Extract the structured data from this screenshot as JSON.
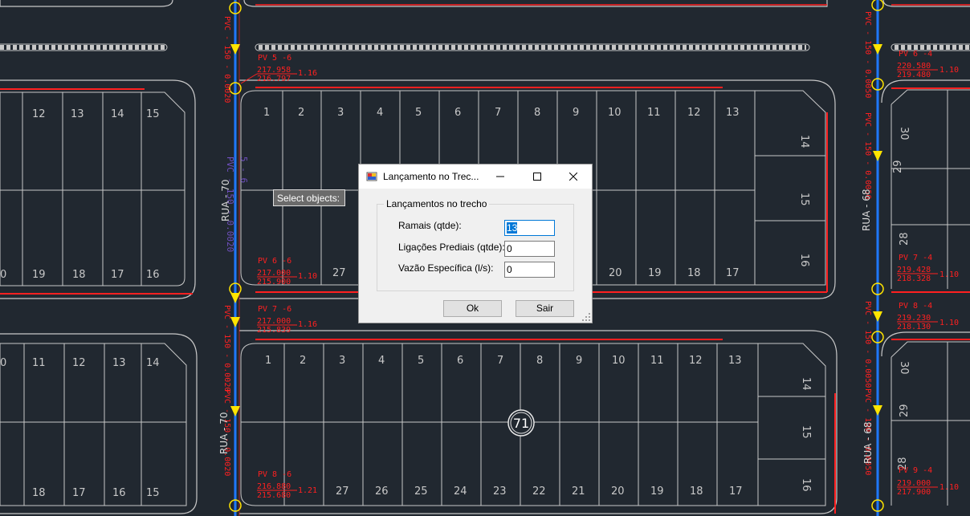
{
  "tooltip": "Select objects:",
  "dialog": {
    "title": "Lançamento no Trec...",
    "group_label": "Lançamentos no trecho",
    "fields": [
      {
        "label": "Ramais (qtde):",
        "value": "13"
      },
      {
        "label": "Ligações Prediais (qtde):",
        "value": "0"
      },
      {
        "label": "Vazão Específica (l/s):",
        "value": "0"
      }
    ],
    "ok_label": "Ok",
    "exit_label": "Sair"
  },
  "drawing": {
    "street_left_top": "RUA - 70",
    "street_left_bottom": "RUA - 70",
    "street_right_top": "RUA - 68",
    "street_right_bottom": "RUA - 68",
    "block_number": "71",
    "pv_left": [
      {
        "label": "PV  5 -6",
        "elev1": "217.958",
        "elev2": "216.797",
        "depth": "1.16"
      },
      {
        "label": "PV  6 -6",
        "elev1": "217.000",
        "elev2": "215.900",
        "depth": "1.10"
      },
      {
        "label": "PV  7 -6",
        "elev1": "217.000",
        "elev2": "215.839",
        "depth": "1.16"
      },
      {
        "label": "PV  8 -6",
        "elev1": "216.880",
        "elev2": "215.680",
        "depth": "1.21"
      }
    ],
    "pv_right": [
      {
        "label": "PV  6 -4",
        "elev1": "220.580",
        "elev2": "219.480",
        "depth": "1.10"
      },
      {
        "label": "PV  7 -4",
        "elev1": "219.428",
        "elev2": "218.328",
        "depth": "1.10"
      },
      {
        "label": "PV  8 -4",
        "elev1": "219.230",
        "elev2": "218.130",
        "depth": "1.10"
      },
      {
        "label": "PV  9 -4",
        "elev1": "219.000",
        "elev2": "217.900",
        "depth": "1.10"
      }
    ],
    "pipe_labels_left": [
      "PVC - 150 - 0.0020",
      "5 - 6",
      "60.60"
    ],
    "pipe_labels_right": [
      "PVC - 150 - 0.0050",
      "6 - 4",
      "60.60"
    ],
    "colors": {
      "background": "#212830",
      "lines": "#c8c8c8",
      "pipe": "#1e78ff",
      "red": "#ff2020",
      "yellow": "#ffe400"
    }
  }
}
